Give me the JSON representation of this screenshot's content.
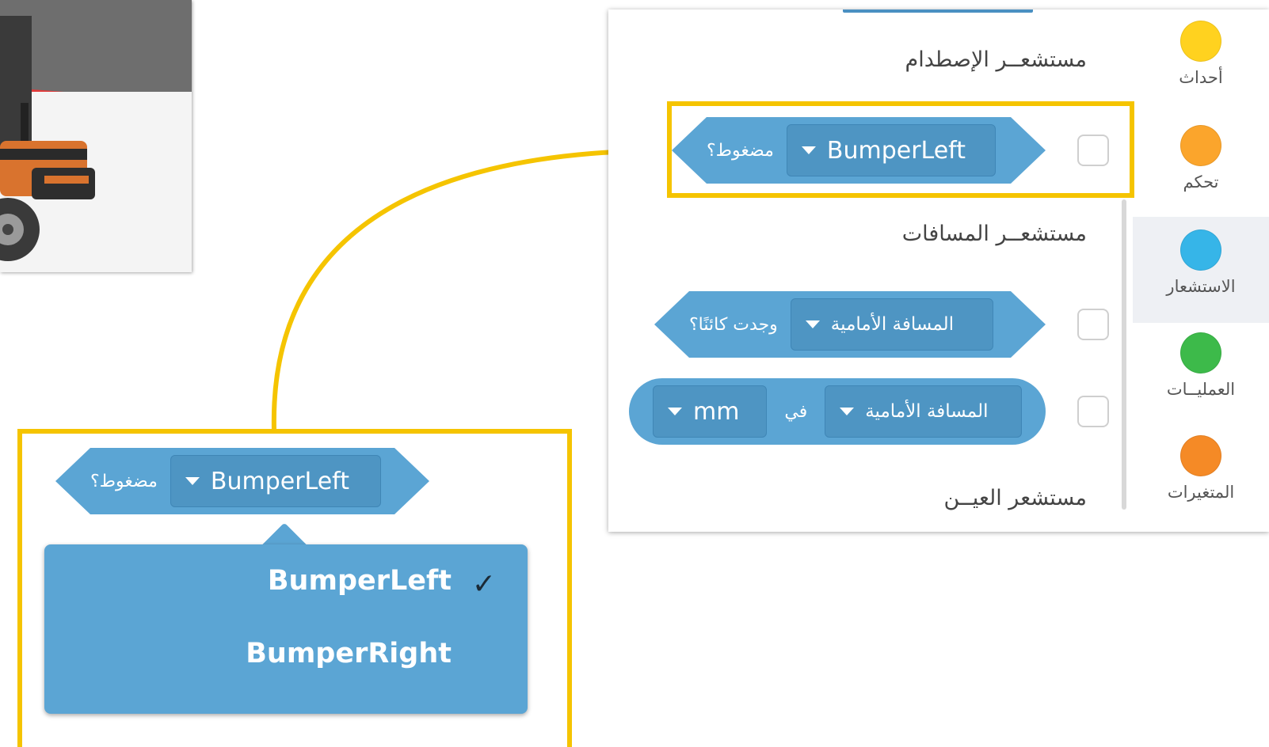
{
  "categories": [
    {
      "label": "أحداث",
      "color": "#ffd21f",
      "icon": "events-dot"
    },
    {
      "label": "تحكم",
      "color": "#fba52c",
      "icon": "control-dot"
    },
    {
      "label": "الاستشعار",
      "color": "#36b5e8",
      "icon": "sensing-dot",
      "selected": true
    },
    {
      "label": "العمليــات",
      "color": "#3dba4a",
      "icon": "operators-dot"
    },
    {
      "label": "المتغيرات",
      "color": "#f58a26",
      "icon": "variables-dot"
    }
  ],
  "sections": {
    "bumper": "مستشعــر الإصطدام",
    "distance": "مستشعــر المسافات",
    "eye": "مستشعر العيــن"
  },
  "blocks": {
    "bumper_pressed": {
      "field": "BumperLeft",
      "suffix": "مضغوط؟"
    },
    "distance_found": {
      "field": "المسافة الأمامية",
      "suffix": "وجدت كائنًا؟"
    },
    "distance_value": {
      "field": "المسافة الأمامية",
      "word": "في",
      "unit": "mm"
    }
  },
  "zoomed_block": {
    "field": "BumperLeft",
    "suffix": "مضغوط؟"
  },
  "dropdown": {
    "items": [
      "BumperLeft",
      "BumperRight"
    ],
    "selected": "BumperLeft",
    "check_mark": "✓"
  },
  "colors": {
    "block": "#5ba5d4",
    "field": "#4e95c3",
    "highlight": "#f5c400"
  }
}
